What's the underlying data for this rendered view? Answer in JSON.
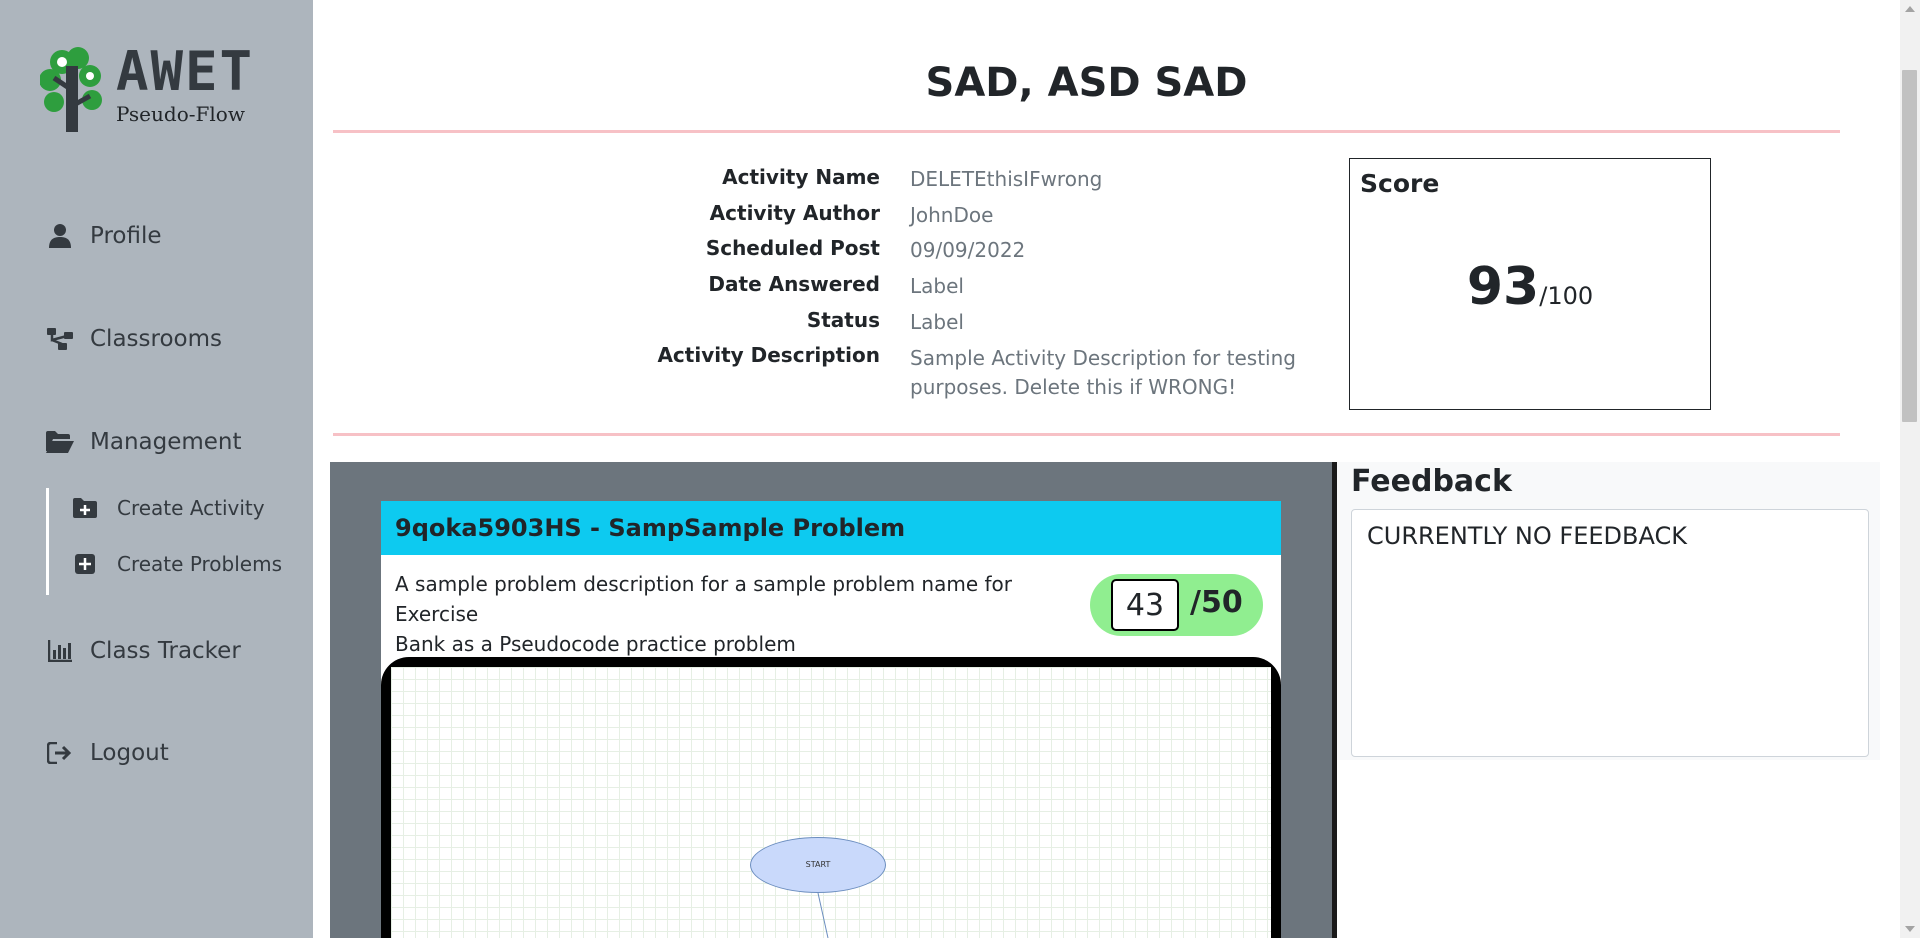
{
  "sidebar": {
    "logo_title": "AWET",
    "logo_subtitle": "Pseudo-Flow",
    "nav": {
      "profile": "Profile",
      "classrooms": "Classrooms",
      "management": "Management",
      "create_activity": "Create Activity",
      "create_problems": "Create Problems",
      "class_tracker": "Class Tracker",
      "logout": "Logout"
    }
  },
  "header": {
    "title": "SAD, ASD SAD"
  },
  "activity": {
    "rows": [
      {
        "label": "Activity Name",
        "value": "DELETEthisIFwrong"
      },
      {
        "label": "Activity Author",
        "value": "JohnDoe"
      },
      {
        "label": "Scheduled Post",
        "value": "09/09/2022"
      },
      {
        "label": "Date Answered",
        "value": "Label"
      },
      {
        "label": "Status",
        "value": "Label"
      },
      {
        "label": "Activity Description",
        "value_line1": "Sample Activity Description for testing",
        "value_line2": "purposes. Delete this if WRONG!"
      }
    ]
  },
  "score": {
    "title": "Score",
    "value": "93",
    "max": "/100"
  },
  "problem": {
    "title": "9qoka5903HS - SampSample Problem",
    "description_line1": "A sample problem description for a sample problem name for Exercise",
    "description_line2": "Bank as a Pseudocode practice problem",
    "points_value": "43",
    "points_max": "/50",
    "flow_start": "START"
  },
  "feedback": {
    "title": "Feedback",
    "text": "CURRENTLY NO FEEDBACK"
  },
  "colors": {
    "sidebar_bg": "#adb5bd",
    "problem_header": "#0dcaf0",
    "points_pill": "#90ee90",
    "divider": "#f7c1c6"
  }
}
